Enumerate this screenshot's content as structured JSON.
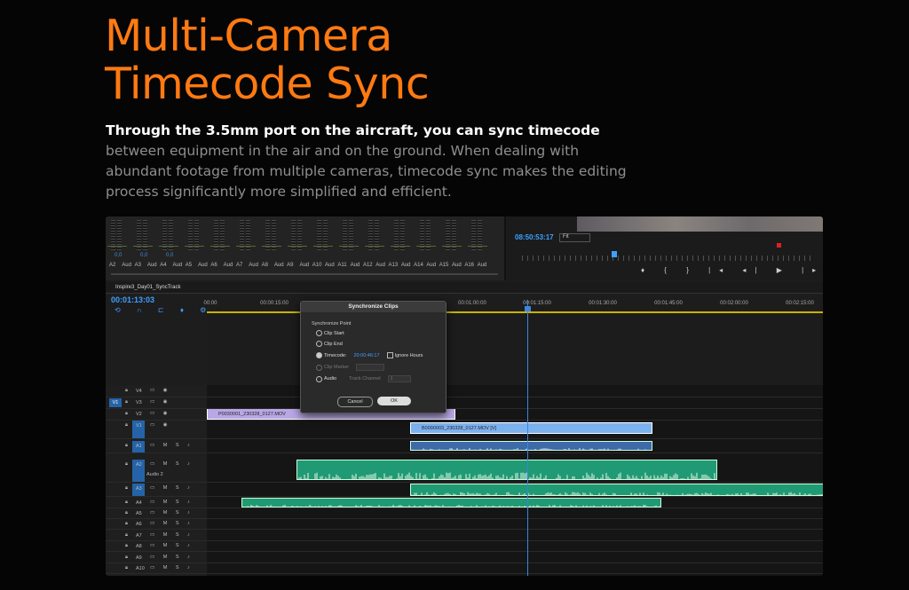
{
  "heading": {
    "line1": "Multi-Camera",
    "line2": "Timecode Sync"
  },
  "description": {
    "highlight": "Through the 3.5mm port on the aircraft, you can sync timecode",
    "rest": " between equipment in the air and on the ground. When dealing with abundant footage from multiple cameras, timecode sync makes the editing process significantly more simplified and efficient."
  },
  "mixer": {
    "values": [
      "0,0",
      "0,0",
      "0,0"
    ],
    "channels": [
      "A2",
      "Aud",
      "A3",
      "Aud",
      "A4",
      "Aud",
      "A5",
      "Aud",
      "A6",
      "Aud",
      "A7",
      "Aud",
      "A8",
      "Aud",
      "A9",
      "Aud",
      "A10",
      "Aud",
      "A11",
      "Aud",
      "A12",
      "Aud",
      "A13",
      "Aud",
      "A14",
      "Aud",
      "A15",
      "Aud",
      "A16",
      "Aud"
    ]
  },
  "monitor": {
    "timecode": "08:50:53:17",
    "zoom": "Fit",
    "controls": "♦ { } |◂ ◂| ▶ |▸ ▸| ⇆ ⇆ ▣ ⊠"
  },
  "sequence": {
    "name": "Inspire3_Day01_SyncTrack",
    "timecode": "00:01:13:03",
    "ruler": [
      "00:00",
      "00:00:15:00",
      "00:01:00:00",
      "00:01:15:00",
      "00:01:30:00",
      "00:01:45:00",
      "00:02:00:00",
      "00:02:15:00"
    ]
  },
  "tracks": {
    "video": [
      {
        "name": "V4"
      },
      {
        "name": "V3",
        "source": "V1"
      },
      {
        "name": "V2"
      },
      {
        "name": "V1",
        "target": true
      }
    ],
    "audio": [
      {
        "name": "A1",
        "target": true
      },
      {
        "name": "A2",
        "target": true,
        "label": "Audio 2"
      },
      {
        "name": "A3",
        "target": true
      },
      {
        "name": "A4"
      },
      {
        "name": "A5"
      },
      {
        "name": "A6"
      },
      {
        "name": "A7"
      },
      {
        "name": "A8"
      },
      {
        "name": "A9"
      },
      {
        "name": "A10"
      }
    ]
  },
  "clips": {
    "v2": "P0030001_230328_0127.MOV",
    "v1": "B0090003_230328_0127.MOV [V]"
  },
  "dialog": {
    "title": "Synchronize Clips",
    "group_label": "Synchronize Point",
    "options": {
      "clip_start": "Clip Start",
      "clip_end": "Clip End",
      "timecode": "Timecode:",
      "timecode_value": "20:00:46:17",
      "ignore_hours": "Ignore Hours",
      "clip_marker": "Clip Marker",
      "audio": "Audio",
      "track_channel": "Track Channel",
      "track_channel_value": "1"
    },
    "cancel": "Cancel",
    "ok": "OK"
  }
}
